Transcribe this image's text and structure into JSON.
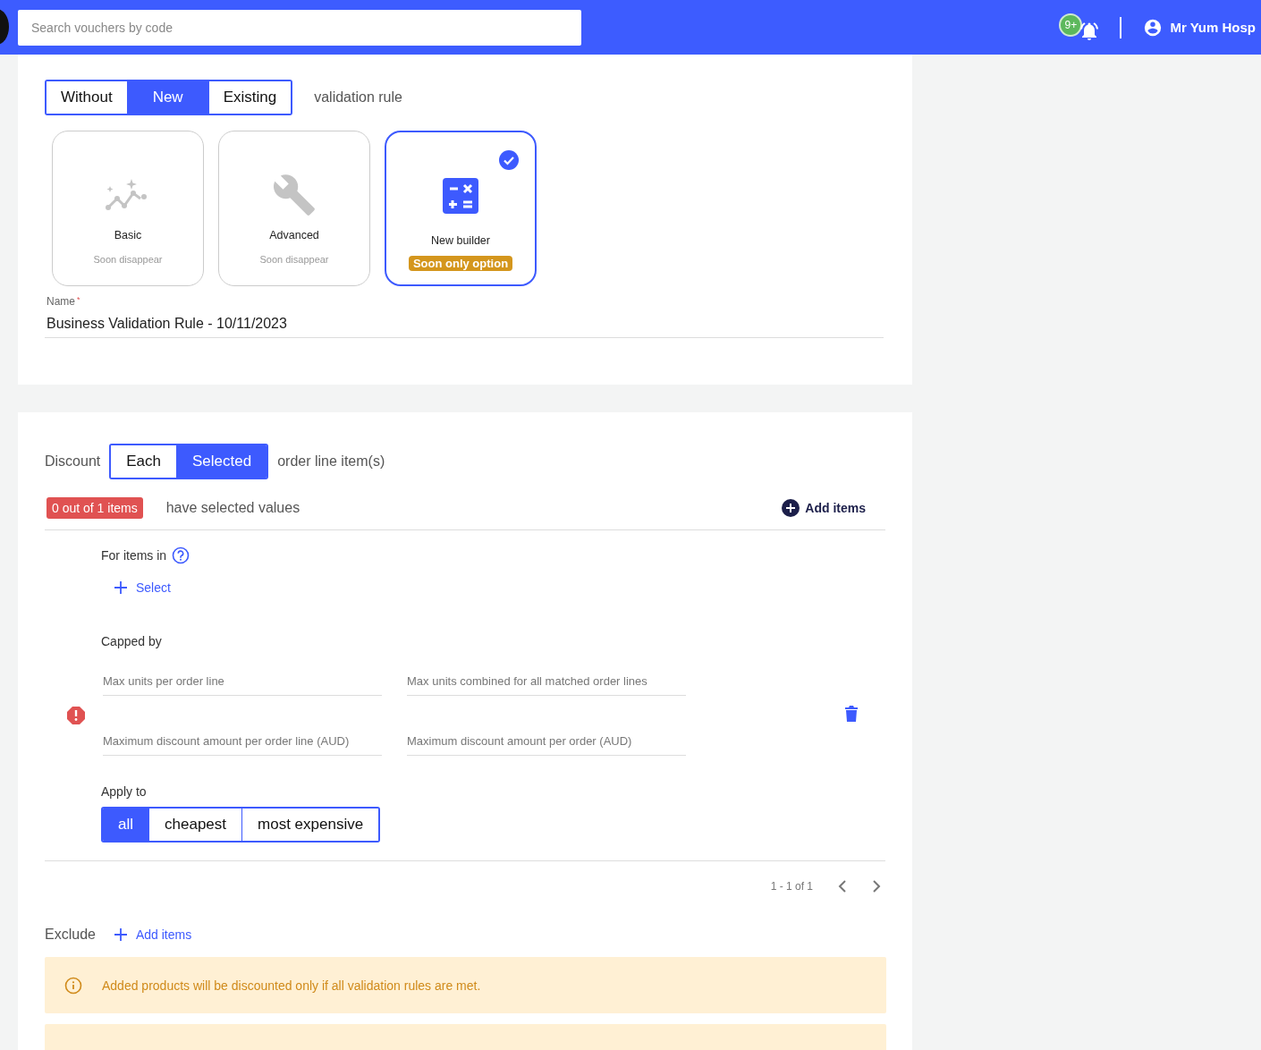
{
  "header": {
    "search": {
      "placeholder": "Search vouchers by code"
    },
    "notification_badge": "9+",
    "user_name": "Mr Yum Hosp"
  },
  "rule_section": {
    "mode_options": [
      {
        "label": "Without",
        "selected": false
      },
      {
        "label": "New",
        "selected": true
      },
      {
        "label": "Existing",
        "selected": false
      }
    ],
    "mode_suffix": "validation rule",
    "builders": [
      {
        "kind": "sparkline",
        "title": "Basic",
        "note": {
          "kind": "plain",
          "text": "Soon disappear"
        },
        "selected": false
      },
      {
        "kind": "wrench",
        "title": "Advanced",
        "note": {
          "kind": "plain",
          "text": "Soon disappear"
        },
        "selected": false
      },
      {
        "kind": "calculator",
        "title": "New builder",
        "note": {
          "kind": "badge",
          "text": "Soon only option"
        },
        "selected": true
      }
    ],
    "name_field": {
      "label": "Name",
      "required_mark": "*",
      "value": "Business Validation Rule - 10/11/2023"
    }
  },
  "discount_section": {
    "label": "Discount",
    "scope_options": [
      {
        "label": "Each",
        "selected": false
      },
      {
        "label": "Selected",
        "selected": true
      }
    ],
    "scope_suffix": "order line item(s)",
    "count_badge": "0 out of 1 items",
    "count_text": "have selected values",
    "add_items": "Add items",
    "for_items_label": "For items in",
    "select_link": "Select",
    "capped_label": "Capped by",
    "has_error": true,
    "cap_fields": [
      {
        "placeholder": "Max units per order line"
      },
      {
        "placeholder": "Max units combined for all matched order lines"
      },
      {
        "placeholder": "Maximum discount amount per order line (AUD)"
      },
      {
        "placeholder": "Maximum discount amount per order (AUD)"
      }
    ],
    "apply_label": "Apply to",
    "apply_options": [
      {
        "label": "all",
        "selected": true
      },
      {
        "label": "cheapest",
        "selected": false
      },
      {
        "label": "most expensive",
        "selected": false
      }
    ],
    "pagination": "1 - 1 of 1"
  },
  "exclude": {
    "label": "Exclude",
    "add_items": "Add items"
  },
  "notice": "Added products will be discounted only if all validation rules are met."
}
